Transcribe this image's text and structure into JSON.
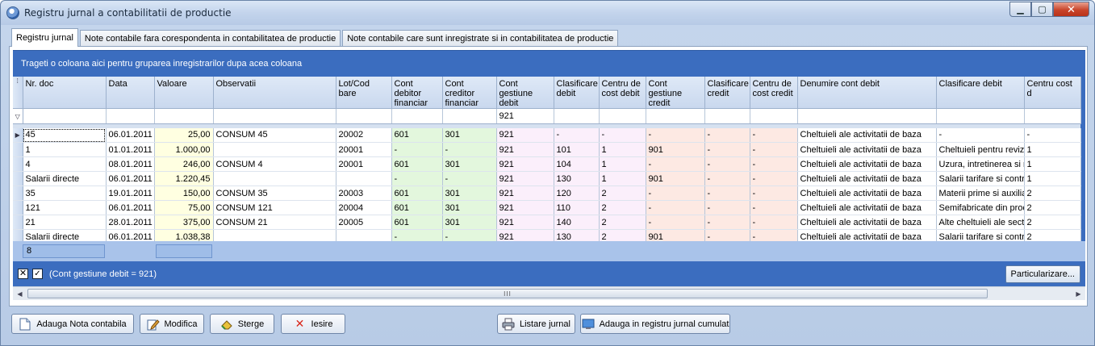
{
  "window": {
    "title": "Registru jurnal a contabilitatii de productie",
    "min_glyph": "▁",
    "max_glyph": "▢",
    "close_glyph": "✕"
  },
  "tabs": [
    {
      "label": "Registru jurnal",
      "active": true
    },
    {
      "label": "Note contabile fara corespondenta in contabilitatea de productie",
      "active": false
    },
    {
      "label": "Note contabile care sunt inregistrate si in contabilitatea de productie",
      "active": false
    }
  ],
  "group_hint": "Trageti o coloana aici pentru gruparea inregistrarilor dupa acea coloana",
  "columns": [
    {
      "label": "Nr. doc",
      "w": 103,
      "cls": ""
    },
    {
      "label": "Data",
      "w": 60,
      "cls": ""
    },
    {
      "label": "Valoare",
      "w": 73,
      "cls": "c-val",
      "num": true
    },
    {
      "label": "Observatii",
      "w": 152,
      "cls": ""
    },
    {
      "label": "Lot/Cod bare",
      "w": 69,
      "cls": ""
    },
    {
      "label": "Cont debitor financiar",
      "w": 63,
      "cls": "c-fin"
    },
    {
      "label": "Cont creditor financiar",
      "w": 67,
      "cls": "c-fin"
    },
    {
      "label": "Cont gestiune debit",
      "w": 71,
      "cls": "c-gd"
    },
    {
      "label": "Clasificare debit",
      "w": 56,
      "cls": "c-gd"
    },
    {
      "label": "Centru de cost debit",
      "w": 58,
      "cls": "c-gd"
    },
    {
      "label": "Cont gestiune credit",
      "w": 73,
      "cls": "c-gc"
    },
    {
      "label": "Clasificare credit",
      "w": 56,
      "cls": "c-gc"
    },
    {
      "label": "Centru de cost credit",
      "w": 59,
      "cls": "c-gc"
    },
    {
      "label": "Denumire cont debit",
      "w": 172,
      "cls": ""
    },
    {
      "label": "Clasificare debit",
      "w": 109,
      "cls": ""
    },
    {
      "label": "Centru cost d",
      "w": 70,
      "cls": ""
    }
  ],
  "filter_values": [
    "",
    "",
    "",
    "",
    "",
    "",
    "",
    "921",
    "",
    "",
    "",
    "",
    "",
    "",
    "",
    ""
  ],
  "rows": [
    [
      "45",
      "06.01.2011",
      "25,00",
      "CONSUM 45",
      "20002",
      "601",
      "301",
      "921",
      "-",
      "-",
      "-",
      "-",
      "-",
      "Cheltuieli ale activitatii de baza",
      "-",
      "-"
    ],
    [
      "1",
      "01.01.2011",
      "1.000,00",
      "",
      "20001",
      "-",
      "-",
      "921",
      "101",
      "1",
      "901",
      "-",
      "-",
      "Cheltuieli ale activitatii de baza",
      "Cheltuieli pentru revizii",
      "1"
    ],
    [
      "4",
      "08.01.2011",
      "246,00",
      "CONSUM 4",
      "20001",
      "601",
      "301",
      "921",
      "104",
      "1",
      "-",
      "-",
      "-",
      "Cheltuieli ale activitatii de baza",
      "Uzura, intretinerea si re",
      "1"
    ],
    [
      "Salarii directe",
      "06.01.2011",
      "1.220,45",
      "",
      "",
      "-",
      "-",
      "921",
      "130",
      "1",
      "901",
      "-",
      "-",
      "Cheltuieli ale activitatii de baza",
      "Salarii tarifare si contrib",
      "1"
    ],
    [
      "35",
      "19.01.2011",
      "150,00",
      "CONSUM 35",
      "20003",
      "601",
      "301",
      "921",
      "120",
      "2",
      "-",
      "-",
      "-",
      "Cheltuieli ale activitatii de baza",
      "Materii prime si auxiliar",
      "2"
    ],
    [
      "121",
      "06.01.2011",
      "75,00",
      "CONSUM 121",
      "20004",
      "601",
      "301",
      "921",
      "110",
      "2",
      "-",
      "-",
      "-",
      "Cheltuieli ale activitatii de baza",
      "Semifabricate din prod",
      "2"
    ],
    [
      "21",
      "28.01.2011",
      "375,00",
      "CONSUM 21",
      "20005",
      "601",
      "301",
      "921",
      "140",
      "2",
      "-",
      "-",
      "-",
      "Cheltuieli ale activitatii de baza",
      "Alte cheltuieli ale secti",
      "2"
    ],
    [
      "Salarii directe",
      "06.01.2011",
      "1.038,38",
      "",
      "",
      "-",
      "-",
      "921",
      "130",
      "2",
      "901",
      "-",
      "-",
      "Cheltuieli ale activitatii de baza",
      "Salarii tarifare si contrib",
      "2"
    ]
  ],
  "summary": {
    "count": "8",
    "value": ""
  },
  "filter": {
    "text": "(Cont gestiune debit = 921)",
    "x_glyph": "✕",
    "check_glyph": "✓",
    "customize_label": "Particularizare..."
  },
  "scroll": {
    "left": "◀",
    "right": "▶",
    "grip": "III"
  },
  "buttons": {
    "add_note": "Adauga Nota contabila",
    "edit": "Modifica",
    "delete": "Sterge",
    "exit": "Iesire",
    "print_journal": "Listare jurnal",
    "add_cumulative": "Adauga in registru jurnal cumulat"
  },
  "colors": {
    "accent": "#3b6dbf",
    "value_col": "#ffffe1",
    "financial_col": "#e3f7dd",
    "debit_col": "#fbeffb",
    "credit_col": "#fde9e3"
  }
}
